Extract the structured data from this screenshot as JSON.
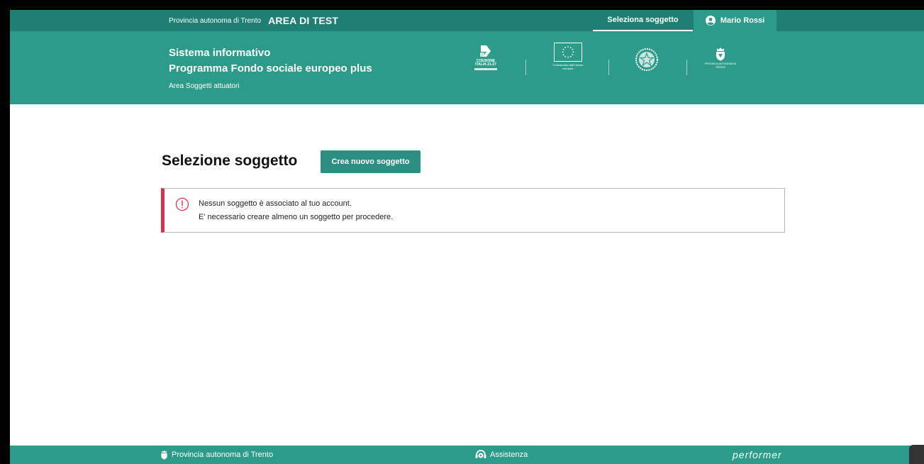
{
  "topbar": {
    "org_small": "Provincia autonoma di Trento",
    "area": "AREA DI TEST",
    "select_label": "Seleziona soggetto",
    "user_name": "Mario Rossi"
  },
  "header": {
    "title_line1": "Sistema informativo",
    "title_line2": "Programma Fondo sociale europeo plus",
    "subtitle": "Area Soggetti attuatori",
    "logos": {
      "coesione": "COESIONE ITALIA 21-27",
      "eu_caption": "Cofinanziato dall'Unione europea",
      "pat_caption": "PROVINCIA AUTONOMA DI TRENTO"
    }
  },
  "main": {
    "title": "Selezione soggetto",
    "new_button": "Crea nuovo soggetto",
    "alert": {
      "line1": "Nessun soggetto è associato al tuo account.",
      "line2": "E' necessario creare almeno un soggetto per procedere."
    }
  },
  "footer": {
    "left": "Provincia autonoma di Trento",
    "middle": "Assistenza",
    "right": "performer"
  },
  "colors": {
    "topbar": "#1f7f72",
    "header": "#2d9b8a",
    "button": "#2d8f82",
    "alert_accent": "#d1344c"
  }
}
